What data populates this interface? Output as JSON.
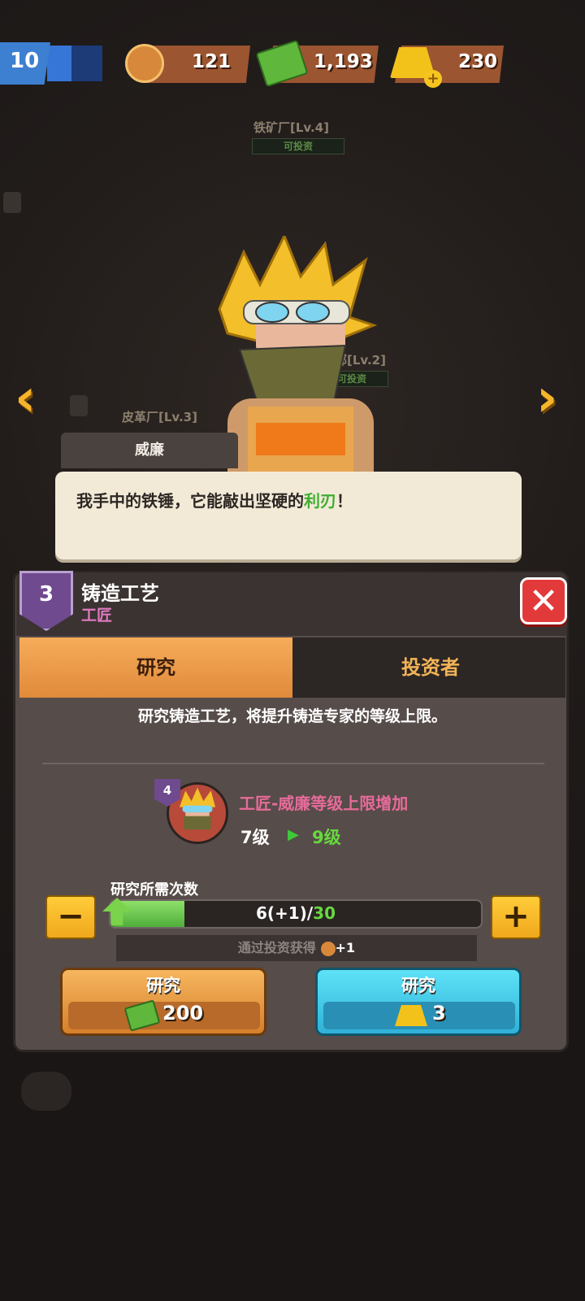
{
  "top_bar": {
    "level": "10",
    "resources": [
      {
        "icon": "coin-icon",
        "value": "121"
      },
      {
        "icon": "cash-icon",
        "value": "1,193"
      },
      {
        "icon": "gold-bar-icon",
        "value": "230"
      }
    ]
  },
  "background": {
    "buildings": [
      {
        "label": "铁矿厂[Lv.4]",
        "status": "可投资"
      },
      {
        "label": "会总部[Lv.2]",
        "status": "可投资"
      },
      {
        "label": "皮革厂[Lv.3]",
        "status": ""
      }
    ]
  },
  "dialog": {
    "speaker": "威廉",
    "text_before": "我手中的铁锤，它能敲出坚硬的",
    "text_highlight": "利刃",
    "text_after": "！"
  },
  "panel": {
    "level": "3",
    "title": "铸造工艺",
    "subtitle": "工匠",
    "tabs": [
      {
        "label": "研究",
        "active": true
      },
      {
        "label": "投资者",
        "active": false
      }
    ],
    "description": "研究铸造工艺，将提升铸造专家的等级上限。",
    "effect": {
      "portrait_badge": "4",
      "text": "工匠-威廉等级上限增加",
      "from_level": "7级",
      "to_level": "9级"
    },
    "research": {
      "label": "研究所需次数",
      "current_text": "6(+1)/",
      "max_text": "30",
      "progress_fraction": 0.2,
      "invest_hint": "通过投资获得",
      "invest_bonus": "+1"
    },
    "buttons": [
      {
        "label": "研究",
        "cost": "200",
        "currency": "cash-icon"
      },
      {
        "label": "研究",
        "cost": "3",
        "currency": "gold-bar-icon"
      }
    ]
  },
  "colors": {
    "accent_orange": "#f6ac5a",
    "accent_blue": "#3fc6e8",
    "highlight_green": "#3fae2f",
    "subtitle_pink": "#e07ac1"
  }
}
